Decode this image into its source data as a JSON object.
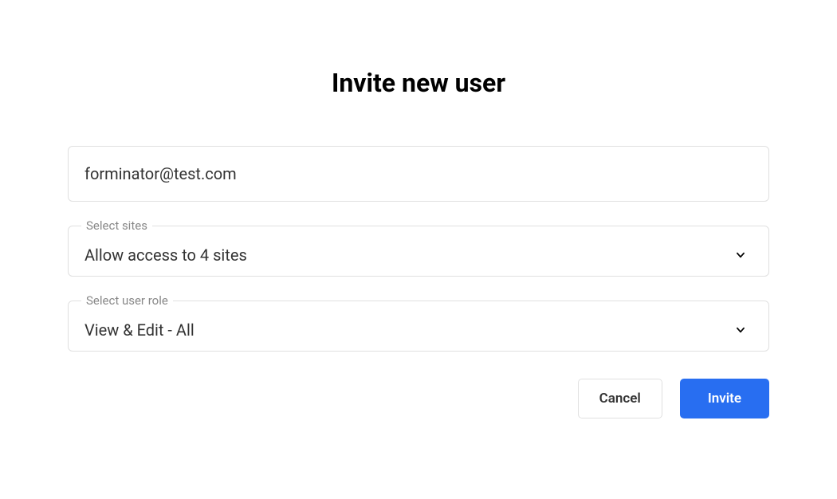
{
  "title": "Invite new user",
  "email": {
    "value": "forminator@test.com"
  },
  "sites": {
    "label": "Select sites",
    "value": "Allow access to 4 sites"
  },
  "role": {
    "label": "Select user role",
    "value": "View & Edit - All"
  },
  "buttons": {
    "cancel": "Cancel",
    "invite": "Invite"
  }
}
